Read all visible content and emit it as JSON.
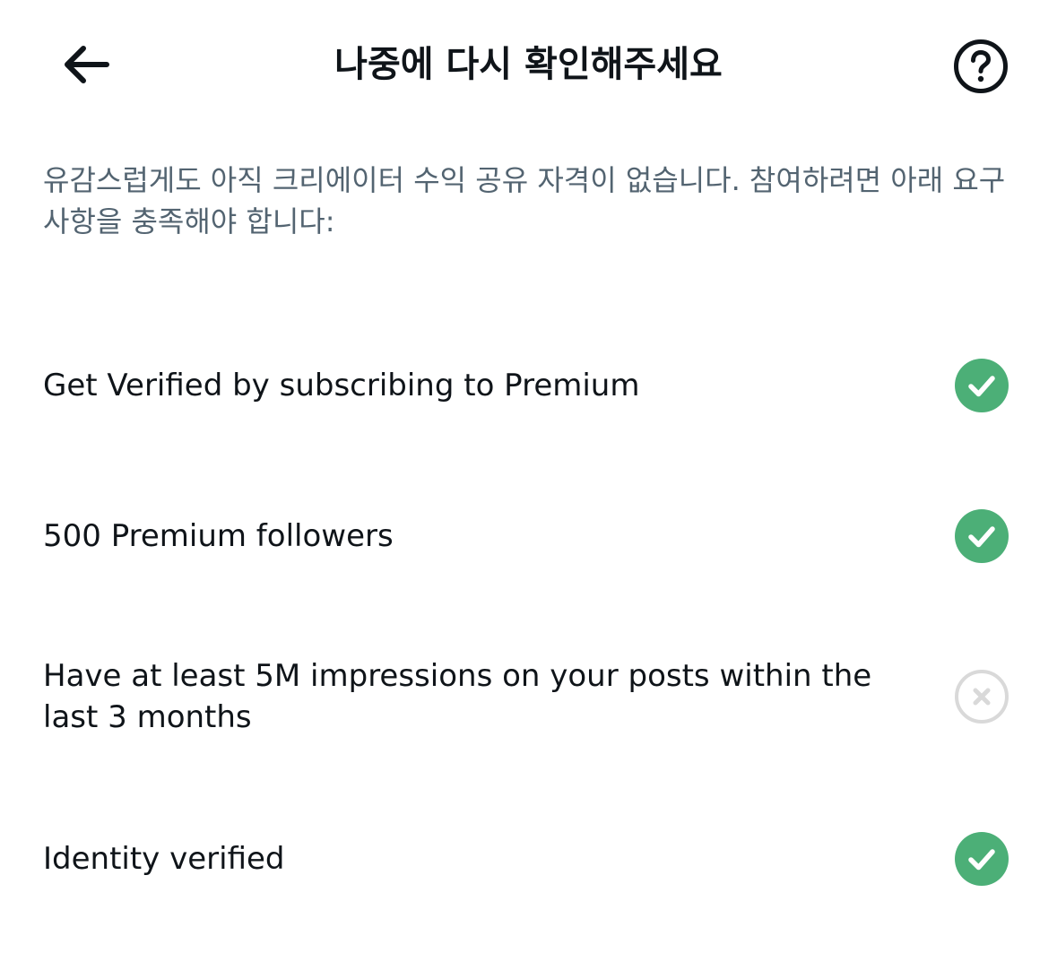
{
  "header": {
    "title": "나중에 다시 확인해주세요",
    "back_icon": "arrow-left-icon",
    "help_icon": "question-circle-icon"
  },
  "description": "유감스럽게도 아직 크리에이터 수익 공유 자격이 없습니다. 참여하려면 아래 요구 사항을 충족해야 합니다:",
  "requirements": [
    {
      "label": "Get Verified by subscribing to Premium",
      "status": "met",
      "icon": "check-circle-icon"
    },
    {
      "label": "500 Premium followers",
      "status": "met",
      "icon": "check-circle-icon"
    },
    {
      "label": "Have at least 5M impressions on your posts within the last 3 months",
      "status": "not-met",
      "icon": "x-circle-icon"
    },
    {
      "label": "Identity verified",
      "status": "met",
      "icon": "check-circle-icon"
    }
  ],
  "colors": {
    "met": "#4caf77",
    "not_met": "#d9d9d9",
    "text_primary": "#0f1419",
    "text_secondary": "#536471"
  }
}
